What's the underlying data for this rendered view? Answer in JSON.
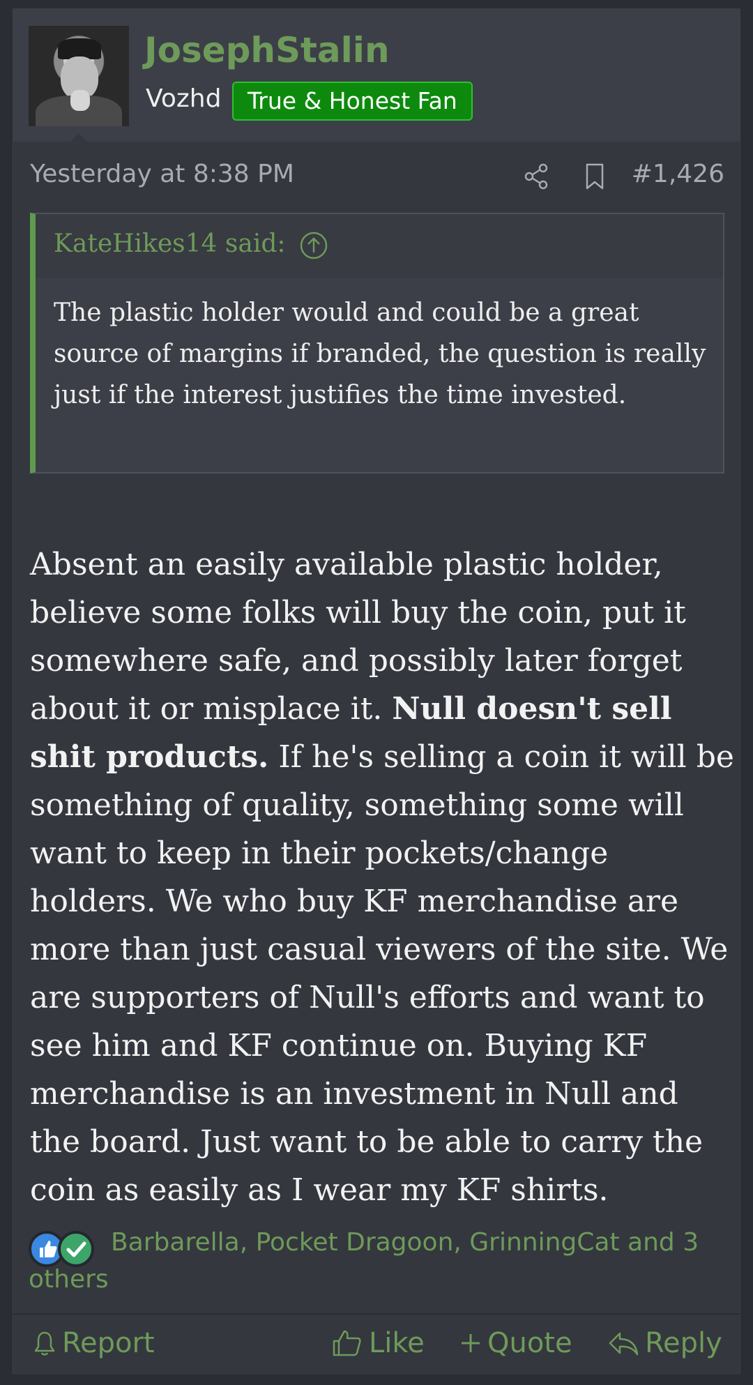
{
  "post": {
    "username": "JosephStalin",
    "user_title": "Vozhd",
    "banner": "True & Honest Fan",
    "date": "Yesterday at 8:38 PM",
    "post_number": "#1,426",
    "icons": {
      "share": "share-icon",
      "bookmark": "bookmark-icon",
      "quote_up": "arrow-up-circle-icon"
    }
  },
  "quote": {
    "author": "KateHikes14 said:",
    "body": "The plastic holder would and could be a great source of margins if branded, the question is really just if the interest justifies the time invested."
  },
  "message": {
    "part1": "Absent an easily available plastic holder, believe some folks will buy the coin, put it somewhere safe, and possibly later forget about it or misplace it. ",
    "bold": "Null doesn't sell shit products.",
    "part2": " If he's selling a coin it will be something of quality, something some will want to keep in their pockets/change holders. We who buy KF merchandise are more than just casual viewers of the site. We are supporters of Null's efforts and want to see him and KF continue on. Buying KF merchandise is an investment in Null and the board. Just want to be able to carry the coin as easily as I wear my KF shirts."
  },
  "reactions": {
    "users": "Barbarella, Pocket Dragoon, GrinningCat and 3 others"
  },
  "actions": {
    "report": "Report",
    "like": "Like",
    "quote": "Quote",
    "reply": "Reply"
  },
  "colors": {
    "accent_green": "#6e9a5a",
    "banner_green": "#0d8a0d",
    "background": "#34373e"
  }
}
